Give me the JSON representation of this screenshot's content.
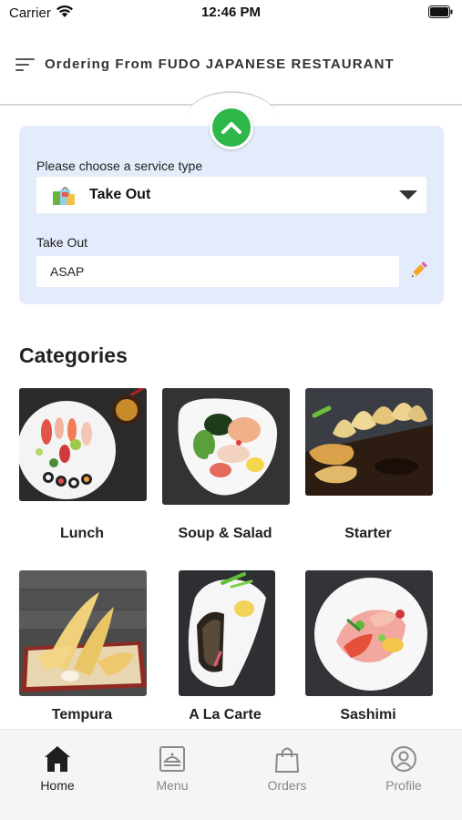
{
  "status_bar": {
    "carrier": "Carrier",
    "time": "12:46 PM"
  },
  "header": {
    "title": "Ordering From FUDO JAPANESE RESTAURANT"
  },
  "service": {
    "prompt": "Please choose a service type",
    "selected": "Take Out",
    "time_label": "Take Out",
    "time_value": "ASAP"
  },
  "categories": {
    "title": "Categories",
    "items": [
      {
        "label": "Lunch"
      },
      {
        "label": "Soup & Salad"
      },
      {
        "label": "Starter"
      },
      {
        "label": "Tempura"
      },
      {
        "label": "A La Carte"
      },
      {
        "label": "Sashimi"
      }
    ]
  },
  "tabs": [
    {
      "label": "Home",
      "icon": "home-icon",
      "active": true
    },
    {
      "label": "Menu",
      "icon": "menu-tray-icon",
      "active": false
    },
    {
      "label": "Orders",
      "icon": "shopping-bag-icon",
      "active": false
    },
    {
      "label": "Profile",
      "icon": "profile-icon",
      "active": false
    }
  ],
  "colors": {
    "accent": "#2fb84a",
    "card_bg": "#e4ebfa",
    "tab_bar": "#f5f5f5"
  }
}
